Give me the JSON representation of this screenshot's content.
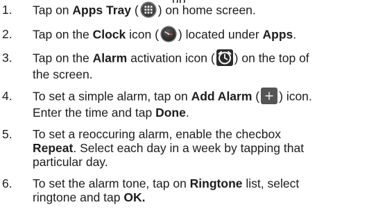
{
  "header_fragment": "up",
  "steps": [
    {
      "num": "1.",
      "t1": "Tap on ",
      "b1": "Apps Tray",
      "t2": " (",
      "icon": "apps-grid-icon",
      "t3": ") on home screen."
    },
    {
      "num": "2.",
      "t1": "Tap on the ",
      "b1": "Clock",
      "t2": " icon (",
      "icon": "clock-app-icon",
      "t3": ") located under ",
      "b2": "Apps",
      "t4": "."
    },
    {
      "num": "3.",
      "t1": "Tap on the ",
      "b1": "Alarm",
      "t2": " activation icon (",
      "icon": "alarm-clock-icon",
      "t3": ") on the top of",
      "line2": "the screen."
    },
    {
      "num": "4.",
      "t1": "To set a simple alarm, tap on ",
      "b1": "Add Alarm",
      "t2": " (",
      "icon": "plus-icon",
      "t3": ") icon.",
      "line2a": "Enter the time and tap ",
      "line2b": "Done",
      "line2c": "."
    },
    {
      "num": "5.",
      "t1": "To set a reoccuring alarm, enable the checbox",
      "b1": "Repeat",
      "t2": ". Select each day in a week by tapping that",
      "line3": "particular day."
    },
    {
      "num": "6.",
      "t1": "To set the alarm tone, tap on ",
      "b1": "Ringtone",
      "t2": " list, select",
      "line2a": "ringtone and tap ",
      "line2b": "OK."
    }
  ]
}
